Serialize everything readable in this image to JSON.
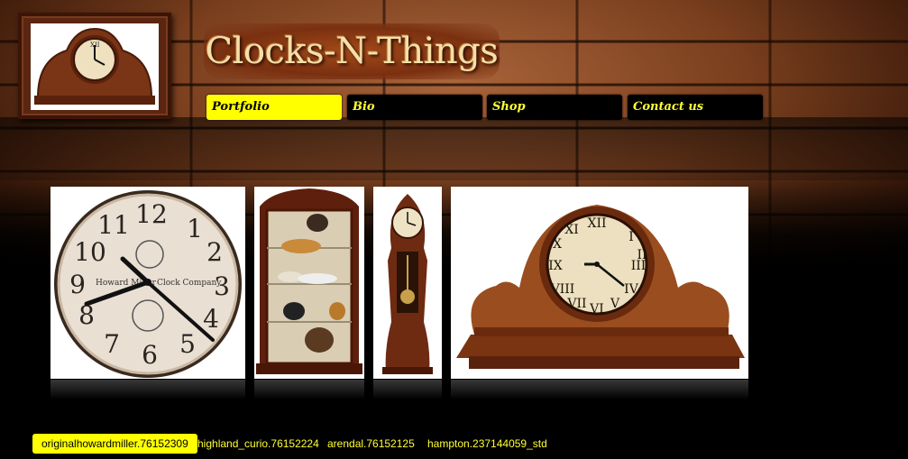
{
  "site": {
    "title": "Clocks-N-Things"
  },
  "nav": [
    {
      "label": "Portfolio",
      "active": true
    },
    {
      "label": "Bio",
      "active": false
    },
    {
      "label": "Shop",
      "active": false
    },
    {
      "label": "Contact us",
      "active": false
    }
  ],
  "gallery": {
    "images": [
      {
        "icon": "wall-clock-image"
      },
      {
        "icon": "curio-cabinet-image"
      },
      {
        "icon": "grandfather-clock-image"
      },
      {
        "icon": "mantel-clock-image"
      }
    ],
    "thumbnails": [
      {
        "label": "originalhowardmiller.76152309",
        "active": true
      },
      {
        "label": "highland_curio.76152224",
        "active": false
      },
      {
        "label": "arendal.76152125",
        "active": false
      },
      {
        "label": "hampton.237144059_std",
        "active": false
      }
    ]
  },
  "colors": {
    "accent": "#ffff00",
    "nav_bg": "#000000",
    "wood": "#7a3f1e"
  }
}
